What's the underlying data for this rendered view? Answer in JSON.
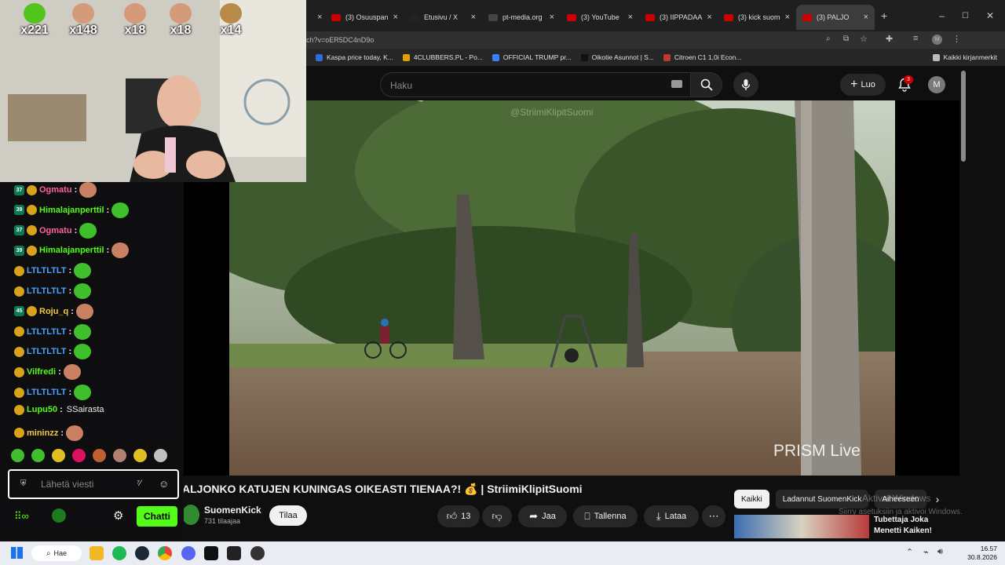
{
  "browser": {
    "tabs": [
      {
        "label": "",
        "color": "#555555",
        "active": false
      },
      {
        "label": "(3) Osuuspan",
        "color": "#cc0000",
        "active": false
      },
      {
        "label": "Etusivu / X",
        "color": "#222222",
        "active": false
      },
      {
        "label": "pt-media.org",
        "color": "#444444",
        "active": false
      },
      {
        "label": "(3) YouTube",
        "color": "#cc0000",
        "active": false
      },
      {
        "label": "(3) IIPPADAA",
        "color": "#cc0000",
        "active": false
      },
      {
        "label": "(3) kick suom",
        "color": "#cc0000",
        "active": false
      },
      {
        "label": "(3) PALJO",
        "color": "#cc0000",
        "active": true
      }
    ],
    "url": "ch?v=oER5DC4nD9o",
    "bookmarks": [
      {
        "label": "Kaspa price today, K...",
        "color": "#2d6cdf"
      },
      {
        "label": "4CLUBBERS.PL - Po...",
        "color": "#e0a000"
      },
      {
        "label": "OFFICIAL TRUMP pr...",
        "color": "#3b82f6"
      },
      {
        "label": "Oikotie Asunnot | S...",
        "color": "#111111"
      },
      {
        "label": "Citroen C1 1,0i Econ...",
        "color": "#c0392b"
      }
    ],
    "all_bookmarks": "Kaikki kirjanmerkit"
  },
  "youtube": {
    "search_placeholder": "Haku",
    "create_label": "Luo",
    "notif_count": "3",
    "avatar_letter": "M",
    "watermark": "@StriimiKlipitSuomi",
    "overlay_logo": "PRISM Live",
    "title": "ALJONKO KATUJEN KUNINGAS OIKEASTI TIENAA?! 💰 | StriimiKlipitSuomi",
    "channel_name": "SuomenKick",
    "subscribers": "731 tilaajaa",
    "subscribe_label": "Tilaa",
    "like_count": "13",
    "share_label": "Jaa",
    "save_label": "Tallenna",
    "download_label": "Lataa",
    "chips": [
      "Kaikki",
      "Ladannut SuomenKick",
      "Aiheeseen"
    ],
    "rec_title_1": "Tubettaja Joka",
    "rec_title_2": "Menetti Kaiken!",
    "activate_windows_1": "Aktivoi Windows",
    "activate_windows_2": "Siirry asetuksiin ja aktivoi Windows."
  },
  "stream": {
    "counters": [
      "x221",
      "x148",
      "x18",
      "x18",
      "x14"
    ],
    "chat": [
      {
        "badge": "37",
        "user": "Ogmatu",
        "color": "#ff5fa2",
        "text": ""
      },
      {
        "badge": "39",
        "user": "Himalajanperttil",
        "color": "#53fc18",
        "text": ""
      },
      {
        "badge": "37",
        "user": "Ogmatu",
        "color": "#ff5fa2",
        "text": ""
      },
      {
        "badge": "39",
        "user": "Himalajanperttil",
        "color": "#53fc18",
        "text": ""
      },
      {
        "badge": "",
        "user": "LTLTLTLT",
        "color": "#4aa3ff",
        "text": ""
      },
      {
        "badge": "",
        "user": "LTLTLTLT",
        "color": "#4aa3ff",
        "text": ""
      },
      {
        "badge": "45",
        "user": "Roju_q",
        "color": "#f5c542",
        "text": ""
      },
      {
        "badge": "",
        "user": "LTLTLTLT",
        "color": "#4aa3ff",
        "text": ""
      },
      {
        "badge": "",
        "user": "LTLTLTLT",
        "color": "#4aa3ff",
        "text": ""
      },
      {
        "badge": "",
        "user": "Vilfredi",
        "color": "#53fc18",
        "text": ""
      },
      {
        "badge": "",
        "user": "LTLTLTLT",
        "color": "#4aa3ff",
        "text": ""
      },
      {
        "badge": "",
        "user": "Lupu50",
        "color": "#53fc18",
        "text": "SSairasta"
      },
      {
        "badge": "",
        "user": "mininzz",
        "color": "#f5c542",
        "text": ""
      }
    ],
    "input_placeholder": "Lähetä viesti",
    "chat_button": "Chatti"
  },
  "taskbar": {
    "search_label": "Hae",
    "time": "16.57",
    "date": "30.8.2026"
  }
}
